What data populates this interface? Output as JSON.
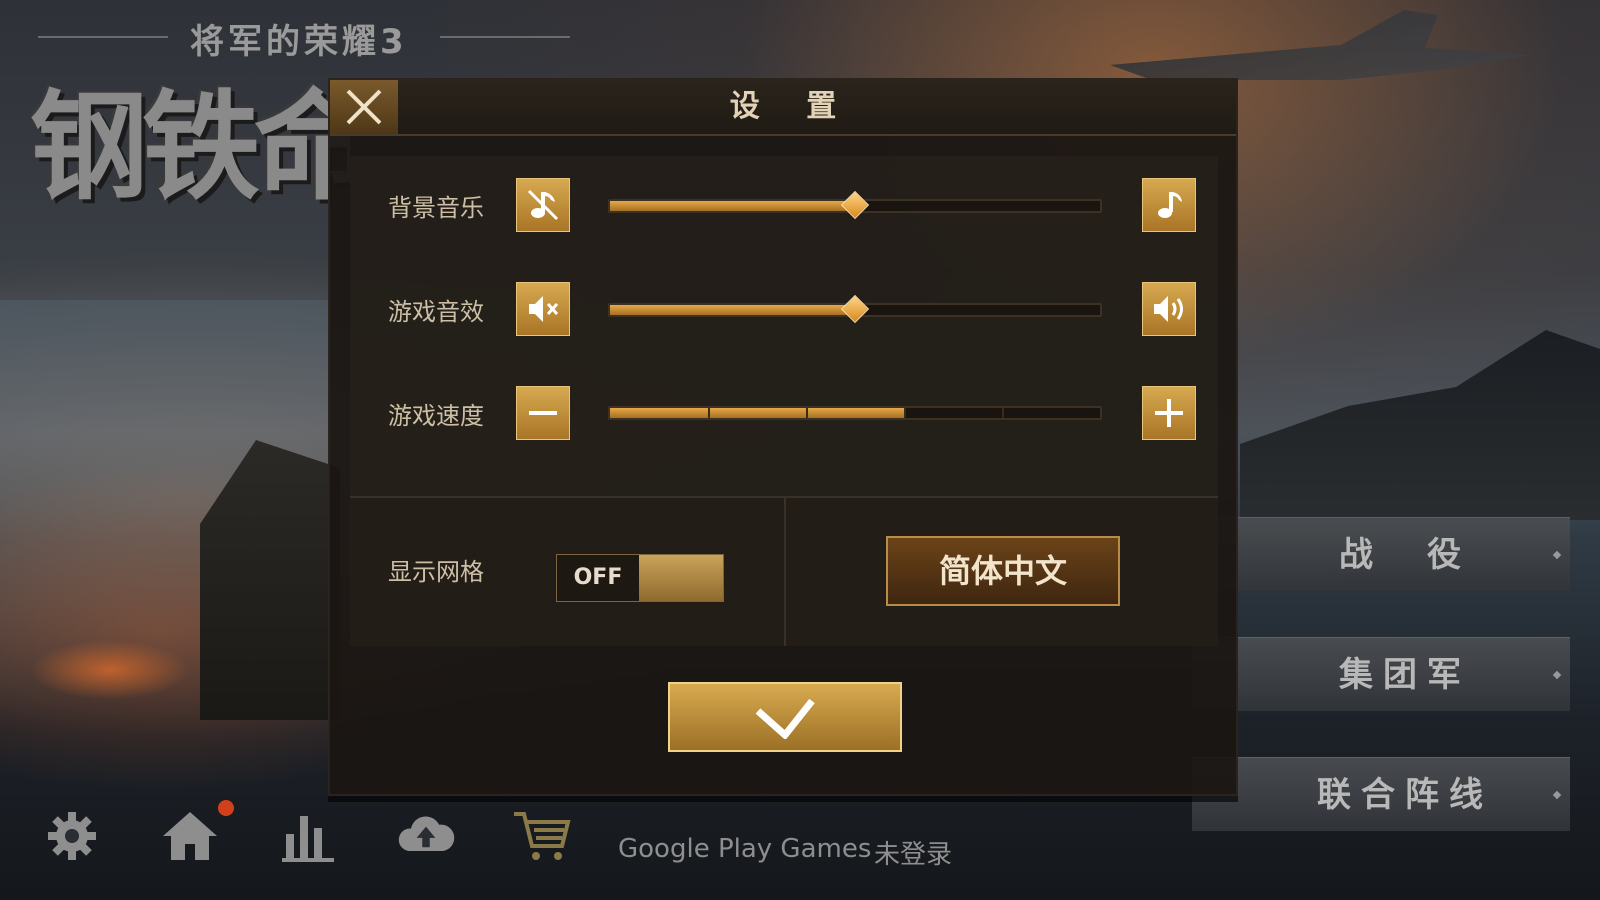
{
  "background": {
    "subtitle": "将军的荣耀3",
    "logo_text": "钢铁命"
  },
  "side_menu": [
    {
      "label": "战　役"
    },
    {
      "label": "集团军"
    },
    {
      "label": "联合阵线"
    }
  ],
  "bottom_bar": {
    "icons": [
      "gear-icon",
      "home-icon",
      "stats-icon",
      "cloud-upload-icon",
      "cart-icon"
    ],
    "google_play_label": "Google Play Games",
    "login_status": "未登录"
  },
  "dialog": {
    "title": "设 置",
    "rows": [
      {
        "label": "背景音乐",
        "left_icon": "music-off-icon",
        "right_icon": "music-note-icon",
        "value_fraction": 0.5
      },
      {
        "label": "游戏音效",
        "left_icon": "speaker-mute-icon",
        "right_icon": "speaker-loud-icon",
        "value_fraction": 0.5
      },
      {
        "label": "游戏速度",
        "left_icon": "minus-icon",
        "right_icon": "plus-icon",
        "value_fraction": 0.6,
        "segments": 5
      }
    ],
    "grid": {
      "label": "显示网格",
      "toggle_state": "OFF"
    },
    "language": {
      "label": "简体中文"
    },
    "confirm_icon": "checkmark-icon"
  },
  "colors": {
    "accent_gold": "#d6a950",
    "dialog_bg": "#1a1612",
    "text_light": "#cdbfa6"
  }
}
